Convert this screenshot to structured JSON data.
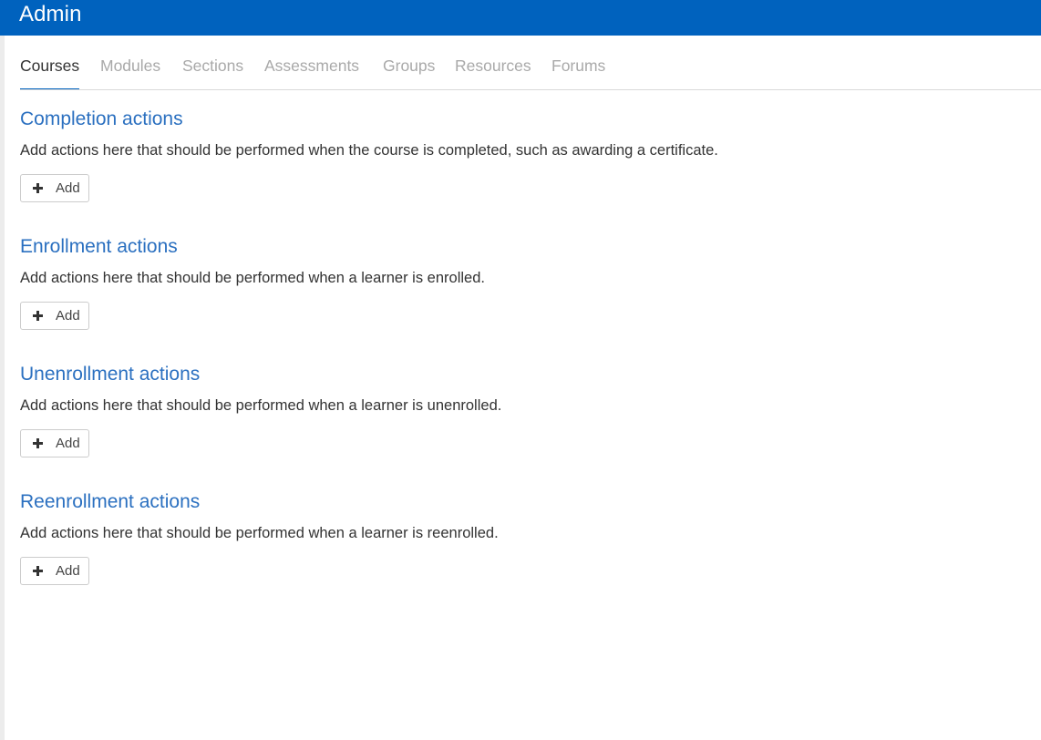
{
  "header": {
    "title": "Admin"
  },
  "tabs": [
    {
      "label": "Courses",
      "active": true
    },
    {
      "label": "Modules",
      "active": false
    },
    {
      "label": "Sections",
      "active": false
    },
    {
      "label": "Assessments",
      "active": false
    },
    {
      "label": "Groups",
      "active": false
    },
    {
      "label": "Resources",
      "active": false
    },
    {
      "label": "Forums",
      "active": false
    }
  ],
  "sections": [
    {
      "title": "Completion actions",
      "description": "Add actions here that should be performed when the course is completed, such as awarding a certificate.",
      "button_label": "Add"
    },
    {
      "title": "Enrollment actions",
      "description": "Add actions here that should be performed when a learner is enrolled.",
      "button_label": "Add"
    },
    {
      "title": "Unenrollment actions",
      "description": "Add actions here that should be performed when a learner is unenrolled.",
      "button_label": "Add"
    },
    {
      "title": "Reenrollment actions",
      "description": "Add actions here that should be performed when a learner is reenrolled.",
      "button_label": "Add"
    }
  ],
  "colors": {
    "header_bg": "#0062be",
    "section_title": "#2b70c0",
    "active_tab_underline": "#0062be"
  },
  "icons": {
    "add": "plus-icon"
  }
}
